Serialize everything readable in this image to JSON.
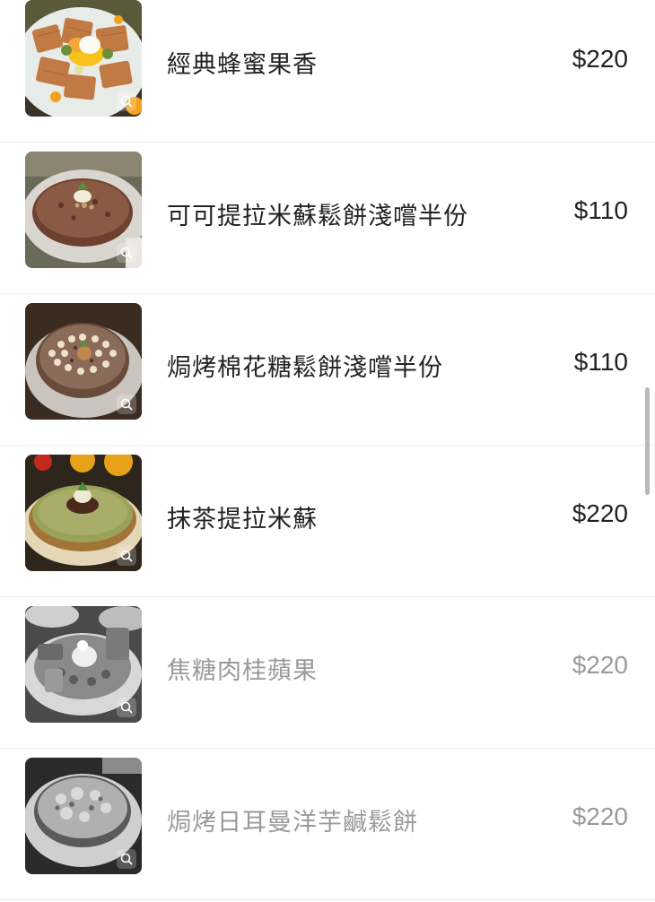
{
  "menu": {
    "items": [
      {
        "name": "經典蜂蜜果香",
        "price": "$220",
        "available": true,
        "photo": "waffle-with-fruit"
      },
      {
        "name": "可可提拉米蘇鬆餅淺嚐半份",
        "price": "$110",
        "available": true,
        "photo": "cocoa-tiramisu-pancake"
      },
      {
        "name": "焗烤棉花糖鬆餅淺嚐半份",
        "price": "$110",
        "available": true,
        "photo": "marshmallow-pancake"
      },
      {
        "name": "抹茶提拉米蘇",
        "price": "$220",
        "available": true,
        "photo": "matcha-tiramisu-pancake"
      },
      {
        "name": "焦糖肉桂蘋果",
        "price": "$220",
        "available": false,
        "photo": "caramel-apple-pancake"
      },
      {
        "name": "焗烤日耳曼洋芋鹹鬆餅",
        "price": "$220",
        "available": false,
        "photo": "baked-potato-pancake"
      }
    ]
  },
  "icons": {
    "zoom": "zoom-magnifier-icon"
  },
  "colors": {
    "text": "#222222",
    "sold_out_text": "#9a9a9a",
    "divider": "#eeeeee",
    "scrollbar": "#b9b9b9"
  }
}
